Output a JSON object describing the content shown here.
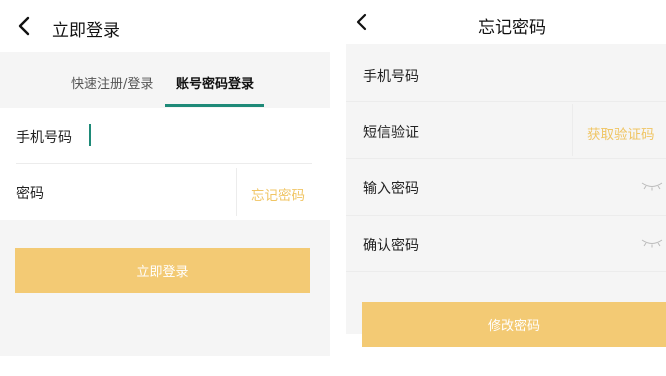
{
  "login_screen": {
    "title": "立即登录",
    "tabs": [
      {
        "label": "快速注册/登录",
        "active": false
      },
      {
        "label": "账号密码登录",
        "active": true
      }
    ],
    "phone_label": "手机号码",
    "password_label": "密码",
    "forgot_password_link": "忘记密码",
    "submit_button": "立即登录"
  },
  "forgot_screen": {
    "title": "忘记密码",
    "phone_label": "手机号码",
    "sms_label": "短信验证",
    "get_code_button": "获取验证码",
    "new_password_label": "输入密码",
    "confirm_password_label": "确认密码",
    "submit_button": "修改密码"
  },
  "colors": {
    "accent_green": "#1e8a78",
    "button_yellow": "#f3ca74",
    "link_yellow": "#f0c564",
    "background_gray": "#f5f5f5"
  },
  "icons": {
    "back": "chevron-left-icon",
    "password_visibility": "eye-closed-icon"
  }
}
